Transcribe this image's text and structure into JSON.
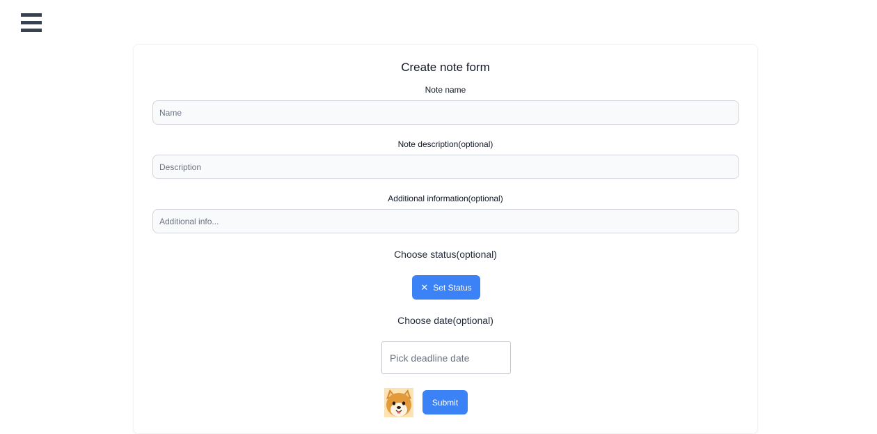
{
  "header": {
    "menu_icon": "hamburger-menu-icon"
  },
  "form": {
    "title": "Create note form",
    "name": {
      "label": "Note name",
      "placeholder": "Name",
      "value": ""
    },
    "description": {
      "label": "Note description(optional)",
      "placeholder": "Description",
      "value": ""
    },
    "additional": {
      "label": "Additional information(optional)",
      "placeholder": "Additional info...",
      "value": ""
    },
    "status": {
      "label": "Choose status(optional)",
      "button_label": "Set Status",
      "button_icon": "close-icon"
    },
    "date": {
      "label": "Choose date(optional)",
      "placeholder": "Pick deadline date",
      "value": ""
    },
    "avatar_icon": "shiba-dog-avatar",
    "submit_label": "Submit",
    "accent_color": "#3b82f6"
  }
}
